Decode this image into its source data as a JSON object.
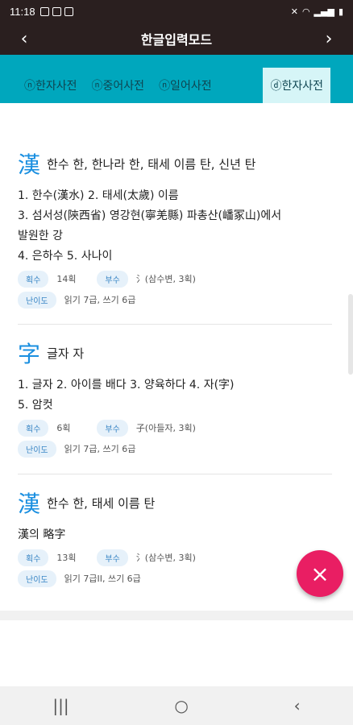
{
  "status": {
    "time": "11:18"
  },
  "appbar": {
    "title": "한글입력모드",
    "back_icon": "‹",
    "forward_icon": "›"
  },
  "tabs": [
    {
      "label": "ⓝ한자사전"
    },
    {
      "label": "ⓝ중어사전"
    },
    {
      "label": "ⓝ일어사전"
    },
    {
      "label": "ⓓ한자사전"
    }
  ],
  "entries": [
    {
      "hanja": "漢",
      "meaning": "한수 한, 한나라 한, 태세 이름 탄, 신년 탄",
      "lines": [
        "1. 한수(漢水)   2. 태세(太歲) 이름",
        "3. 섬서성(陝西省) 영강현(寧羌縣) 파총산(嶓冢山)에서",
        "발원한 강",
        "4. 은하수   5. 사나이"
      ],
      "stroke_label": "획수",
      "stroke_value": "14획",
      "radical_label": "부수",
      "radical_value": "氵(삼수변, 3획)",
      "level_label": "난이도",
      "level_value": "읽기 7급, 쓰기 6급"
    },
    {
      "hanja": "字",
      "meaning": "글자 자",
      "lines": [
        "1. 글자   2. 아이를 배다   3. 양육하다   4. 자(字)",
        "5. 암컷"
      ],
      "stroke_label": "획수",
      "stroke_value": "6획",
      "radical_label": "부수",
      "radical_value": "子(아들자, 3획)",
      "level_label": "난이도",
      "level_value": "읽기 7급, 쓰기 6급"
    },
    {
      "hanja": "漢",
      "meaning": "한수 한, 태세 이름 탄",
      "lines": [
        "漢의 略字"
      ],
      "stroke_label": "획수",
      "stroke_value": "13획",
      "radical_label": "부수",
      "radical_value": "氵(삼수변, 3획)",
      "level_label": "난이도",
      "level_value": "읽기 7급II, 쓰기 6급"
    }
  ],
  "fab": {
    "icon": "×"
  },
  "navbar": {
    "recents_icon": "|||",
    "home_icon": "○",
    "back_icon": "‹"
  }
}
